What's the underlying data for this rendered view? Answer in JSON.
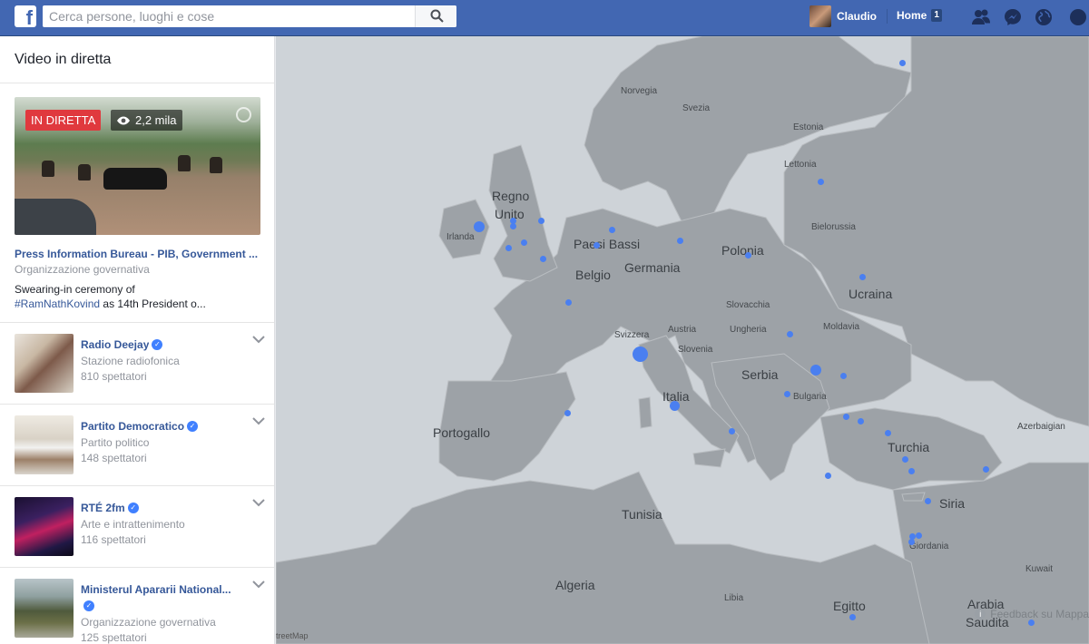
{
  "topbar": {
    "logo": "f",
    "search_placeholder": "Cerca persone, luoghi e cose",
    "user_name": "Claudio",
    "home_label": "Home",
    "home_count": "1",
    "brand_color": "#4267b2"
  },
  "sidebar": {
    "title": "Video in diretta",
    "featured": {
      "live_label": "IN DIRETTA",
      "views": "2,2 mila",
      "name": "Press Information Bureau - PIB, Government ...",
      "category": "Organizzazione governativa",
      "desc_start": "Swearing-in ceremony of",
      "hashtag": "#RamNathKovind",
      "desc_end": " as 14th President o..."
    },
    "items": [
      {
        "name": "Radio Deejay",
        "category": "Stazione radiofonica",
        "viewers": "810 spettatori"
      },
      {
        "name": "Partito Democratico",
        "category": "Partito politico",
        "viewers": "148 spettatori"
      },
      {
        "name": "RTÉ 2fm",
        "category": "Arte e intrattenimento",
        "viewers": "116 spettatori"
      },
      {
        "name": "Ministerul Apararii National...",
        "category": "Organizzazione governativa",
        "viewers": "125 spettatori"
      }
    ]
  },
  "map": {
    "labels": {
      "norvegia": "Norvegia",
      "svezia": "Svezia",
      "estonia": "Estonia",
      "lettonia": "Lettonia",
      "regno_unito_1": "Regno",
      "regno_unito_2": "Unito",
      "irlanda": "Irlanda",
      "paesi_bassi": "Paesi Bassi",
      "belgio": "Belgio",
      "germania": "Germania",
      "polonia": "Polonia",
      "bielorussia": "Bielorussia",
      "ucraina": "Ucraina",
      "slovacchia": "Slovacchia",
      "moldavia": "Moldavia",
      "ungheria": "Ungheria",
      "svizzera": "Svizzera",
      "austria": "Austria",
      "slovenia": "Slovenia",
      "serbia": "Serbia",
      "bulgaria": "Bulgaria",
      "italia": "Italia",
      "portogallo": "Portogallo",
      "turchia": "Turchia",
      "azerbaigian": "Azerbaigian",
      "siria": "Siria",
      "giordania": "Giordania",
      "kuwait": "Kuwait",
      "tunisia": "Tunisia",
      "algeria": "Algeria",
      "libia": "Libia",
      "egitto": "Egitto",
      "arabia_1": "Arabia",
      "arabia_2": "Saudita"
    },
    "attribution": "treetMap",
    "feedback": "Feedback su Mappa"
  }
}
